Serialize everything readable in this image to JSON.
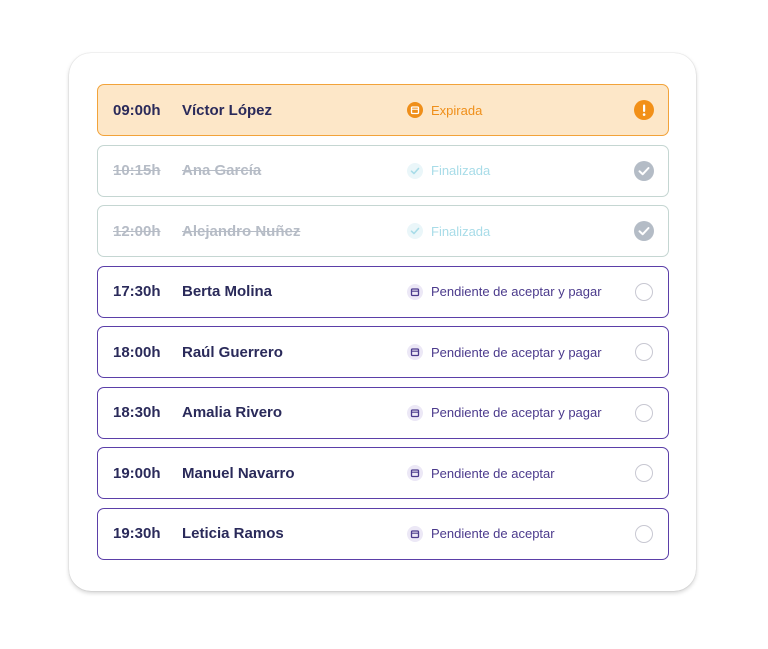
{
  "colors": {
    "accent_purple": "#5b3fa8",
    "expired_orange": "#f2a33a",
    "expired_bg": "#fde7c8",
    "done_gray": "#b6bcc6",
    "done_check": "#a8dce8"
  },
  "appointments": [
    {
      "time": "09:00h",
      "name": "Víctor López",
      "status": "Expirada",
      "state": "expired",
      "status_icon": "calendar-icon",
      "right_icon": "alert-icon"
    },
    {
      "time": "10:15h",
      "name": "Ana García",
      "status": "Finalizada",
      "state": "done",
      "status_icon": "check-icon",
      "right_icon": "check-circle-icon"
    },
    {
      "time": "12:00h",
      "name": "Alejandro Nuñez",
      "status": "Finalizada",
      "state": "done",
      "status_icon": "check-icon",
      "right_icon": "check-circle-icon"
    },
    {
      "time": "17:30h",
      "name": "Berta Molina",
      "status": "Pendiente de aceptar y pagar",
      "state": "pending",
      "status_icon": "calendar-icon",
      "right_icon": "empty-circle-icon"
    },
    {
      "time": "18:00h",
      "name": "Raúl Guerrero",
      "status": "Pendiente de aceptar y pagar",
      "state": "pending",
      "status_icon": "calendar-icon",
      "right_icon": "empty-circle-icon"
    },
    {
      "time": "18:30h",
      "name": "Amalia Rivero",
      "status": "Pendiente de aceptar y pagar",
      "state": "pending",
      "status_icon": "calendar-icon",
      "right_icon": "empty-circle-icon"
    },
    {
      "time": "19:00h",
      "name": "Manuel Navarro",
      "status": "Pendiente de aceptar",
      "state": "pending",
      "status_icon": "calendar-icon",
      "right_icon": "empty-circle-icon"
    },
    {
      "time": "19:30h",
      "name": "Leticia Ramos",
      "status": "Pendiente de aceptar",
      "state": "pending",
      "status_icon": "calendar-icon",
      "right_icon": "empty-circle-icon"
    }
  ]
}
